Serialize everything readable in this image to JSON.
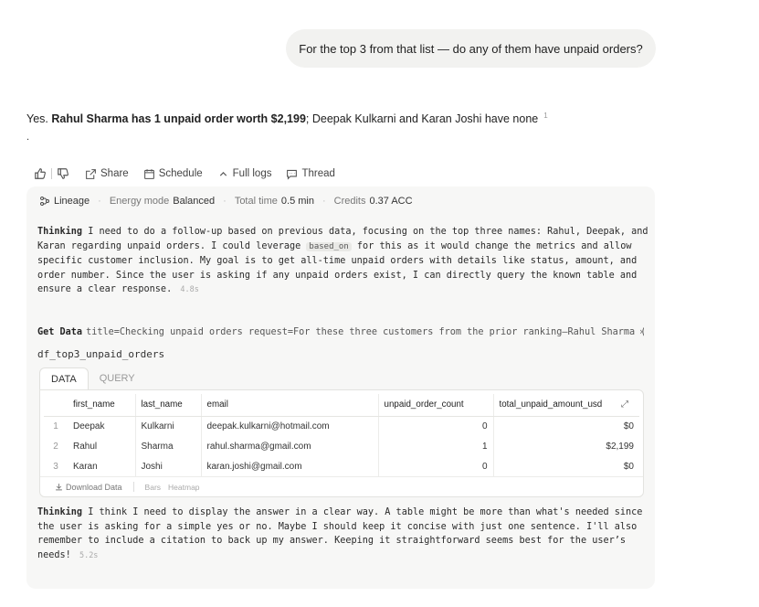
{
  "user_message": "For the top 3 from that list — do any of them have unpaid orders?",
  "answer": {
    "prefix": "Yes. ",
    "bold": "Rahul Sharma has 1 unpaid order worth $2,199",
    "suffix": "; Deepak Kulkarni and Karan Joshi have none",
    "citation": "1",
    "trailing": "."
  },
  "actions": {
    "share": "Share",
    "schedule": "Schedule",
    "full_logs": "Full logs",
    "thread": "Thread"
  },
  "meta": {
    "lineage": "Lineage",
    "energy_label": "Energy mode",
    "energy_value": "Balanced",
    "time_label": "Total time",
    "time_value": "0.5 min",
    "credits_label": "Credits",
    "credits_value": "0.37 ACC"
  },
  "thinking1": {
    "label": "Thinking",
    "text_a": "I need to do a follow-up based on previous data, focusing on the top three names: Rahul, Deepak, and Karan regarding unpaid orders. I could leverage",
    "code": "based_on",
    "text_b": "for this as it would change the metrics and allow specific customer inclusion. My goal is to get all-time unpaid orders with details like status, amount, and order number. Since the user is asking if any unpaid orders exist, I can directly query the known table and ensure a clear response.",
    "time": "4.8s"
  },
  "get_data": {
    "label": "Get Data",
    "details": "title=Checking unpaid orders request=For these three customers from the prior ranking—Rahul Sharma (rah…",
    "chevron": "›"
  },
  "df_name": "df_top3_unpaid_orders",
  "tabs": [
    "DATA",
    "QUERY"
  ],
  "table": {
    "columns": [
      "first_name",
      "last_name",
      "email",
      "unpaid_order_count",
      "total_unpaid_amount_usd"
    ],
    "rows": [
      {
        "n": "1",
        "first_name": "Deepak",
        "last_name": "Kulkarni",
        "email": "deepak.kulkarni@hotmail.com",
        "count": "0",
        "amount": "$0"
      },
      {
        "n": "2",
        "first_name": "Rahul",
        "last_name": "Sharma",
        "email": "rahul.sharma@gmail.com",
        "count": "1",
        "amount": "$2,199"
      },
      {
        "n": "3",
        "first_name": "Karan",
        "last_name": "Joshi",
        "email": "karan.joshi@gmail.com",
        "count": "0",
        "amount": "$0"
      }
    ]
  },
  "table_footer": {
    "download": "Download Data",
    "bars": "Bars",
    "heatmap": "Heatmap"
  },
  "thinking2": {
    "label": "Thinking",
    "text": "I think I need to display the answer in a clear way. A table might be more than what's needed since the user is asking for a simple yes or no. Maybe I should keep it concise with just one sentence. I'll also remember to include a citation to back up my answer. Keeping it straightforward seems best for the user’s needs!",
    "time": "5.2s"
  }
}
